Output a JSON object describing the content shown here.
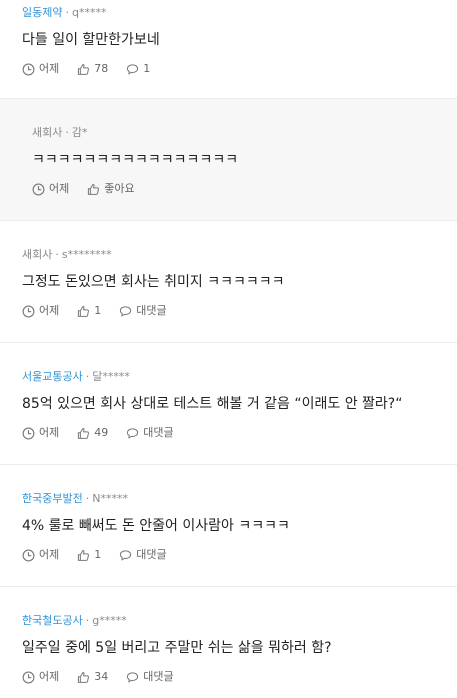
{
  "colors": {
    "accent": "#2f93d8",
    "muted": "#8a8a8a",
    "reply_background": "#f7f7f7"
  },
  "comments": [
    {
      "company": "일동제약",
      "user": "q*****",
      "text": "다들 일이 할만한가보네",
      "time": "어제",
      "likes": "78",
      "replies": "1"
    },
    {
      "company": "새회사",
      "user": "감*",
      "text": "ㅋㅋㅋㅋㅋㅋㅋㅋㅋㅋㅋㅋㅋㅋㅋㅋ",
      "time": "어제",
      "like_label": "좋아요"
    },
    {
      "company": "새회사",
      "user": "s********",
      "text": "그정도 돈있으면 회사는 취미지 ㅋㅋㅋㅋㅋㅋ",
      "time": "어제",
      "likes": "1",
      "reply_label": "대댓글"
    },
    {
      "company": "서울교통공사",
      "user": "달*****",
      "text": "85억 있으면 회사 상대로 테스트 해볼 거 같음 “이래도 안 짤라?“",
      "time": "어제",
      "likes": "49",
      "reply_label": "대댓글"
    },
    {
      "company": "한국중부발전",
      "user": "N*****",
      "text": "4% 룰로 빼써도 돈 안줄어 이사람아 ㅋㅋㅋㅋ",
      "time": "어제",
      "likes": "1",
      "reply_label": "대댓글"
    },
    {
      "company": "한국철도공사",
      "user": "g*****",
      "text": "일주일 중에 5일 버리고 주말만 쉬는 삶을 뭐하러 함?",
      "time": "어제",
      "likes": "34",
      "reply_label": "대댓글"
    }
  ],
  "icons": {
    "time": "clock-icon",
    "like": "thumbs-up-icon",
    "reply": "speech-bubble-icon"
  }
}
